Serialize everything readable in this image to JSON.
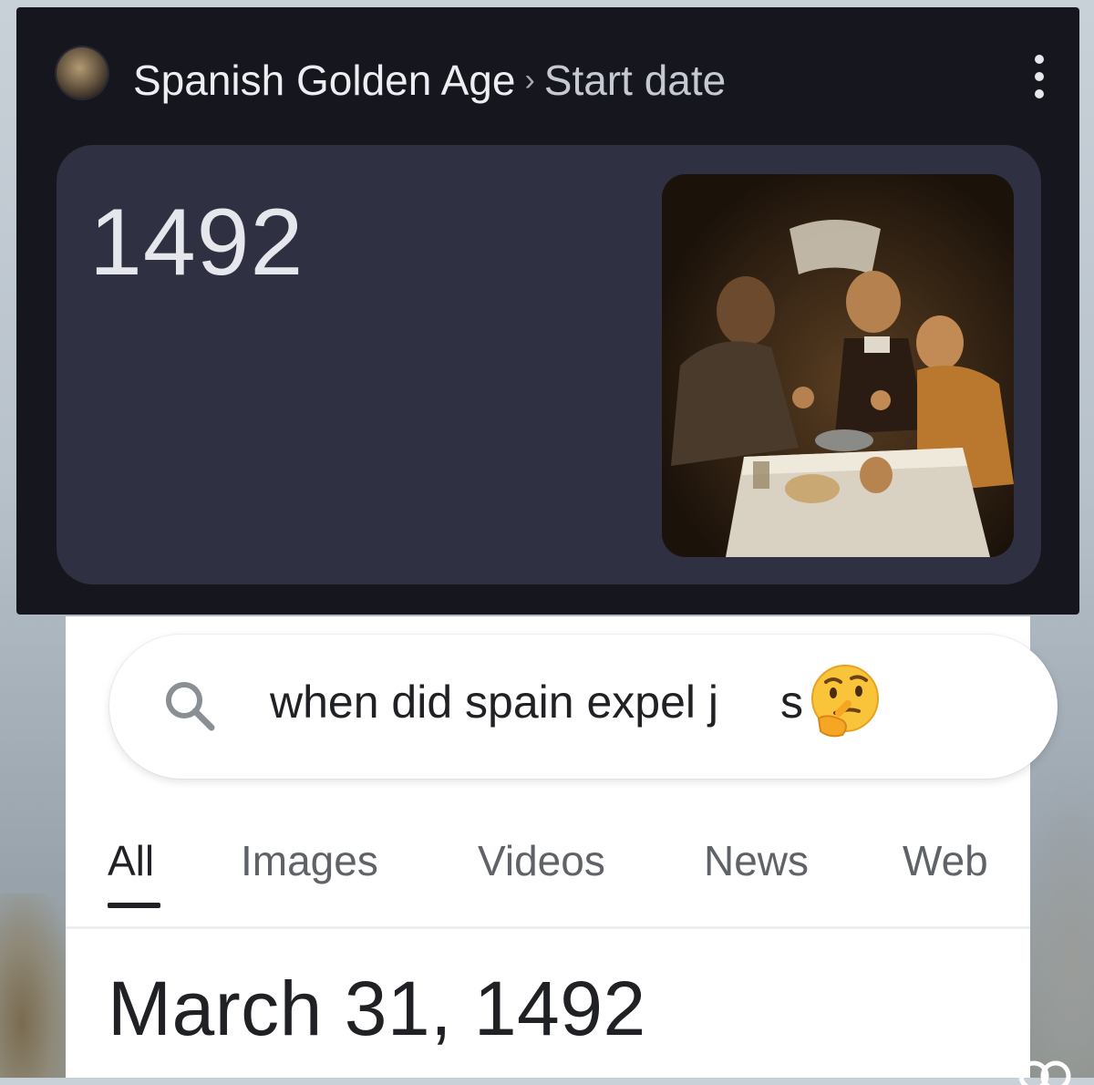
{
  "knowledge_panel": {
    "entity": "Spanish Golden Age",
    "separator": "›",
    "attribute": "Start date",
    "value": "1492",
    "favicon_icon": "painting-thumbnail",
    "image": "painting-three-men-at-table"
  },
  "search": {
    "query": "when did spain expel j",
    "query_suffix": "s",
    "icon": "search-icon",
    "emoji": "thinking-face"
  },
  "tabs": [
    {
      "label": "All",
      "active": true
    },
    {
      "label": "Images",
      "active": false
    },
    {
      "label": "Videos",
      "active": false
    },
    {
      "label": "News",
      "active": false
    },
    {
      "label": "Web",
      "active": false
    }
  ],
  "result": {
    "answer": "March 31, 1492"
  },
  "colors": {
    "dark_bg": "#16161f",
    "card_bg": "#2f3142",
    "text_dark": "#202124",
    "text_muted": "#5f6368"
  }
}
